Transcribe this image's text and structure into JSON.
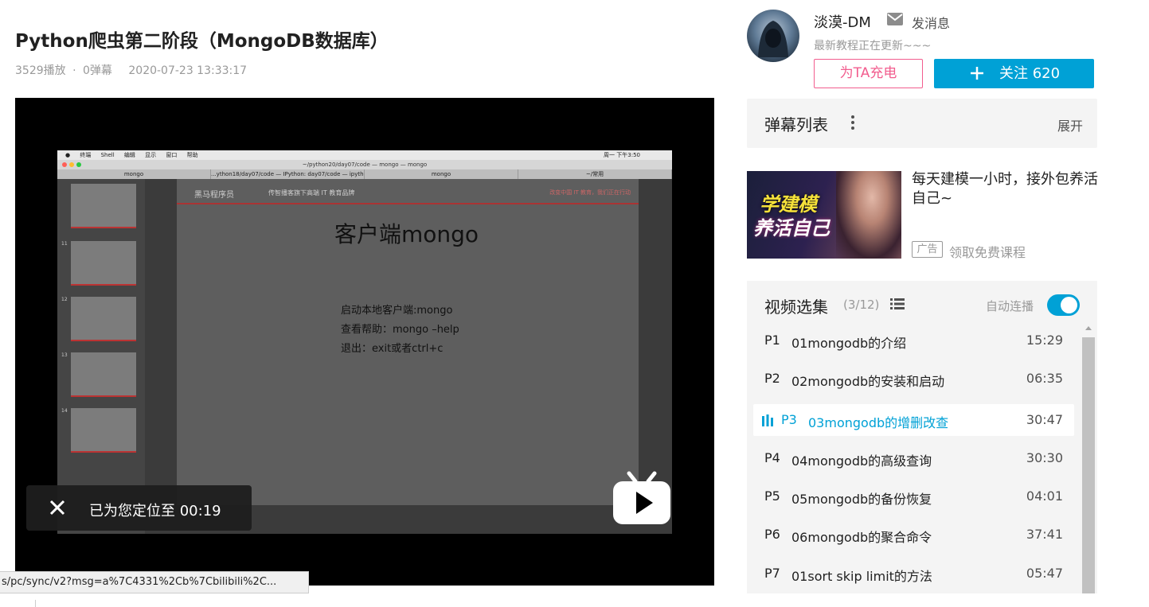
{
  "video": {
    "title": "Python爬虫第二阶段（MongoDB数据库）",
    "plays": "3529播放",
    "separator": "·",
    "danmaku_count": "0弹幕",
    "date": "2020-07-23 13:33:17"
  },
  "player": {
    "terminal_title": "~/python20/day07/code — mongo — mongo",
    "menubar": [
      "终端",
      "Shell",
      "编辑",
      "显示",
      "窗口",
      "帮助"
    ],
    "menubar_right": "周一 下午3:50",
    "tabs": [
      "mongo",
      "...ython18/day07/code — IPython: day07/code — ipython",
      "mongo",
      "~/常用"
    ],
    "slide": {
      "brand": "黑马程序员",
      "subtitle": "传智播客旗下高端 IT 教育品牌",
      "slogan": "改变中国 IT 教育，我们正在行动",
      "heading": "客户端mongo",
      "lines": [
        "启动本地客户端:mongo",
        "查看帮助：mongo –help",
        "退出：exit或者ctrl+c"
      ]
    },
    "thumb_numbers": [
      "11",
      "12",
      "13",
      "14"
    ],
    "toast": "已为您定位至 00:19"
  },
  "url_tip": "s/pc/sync/v2?msg=a%7C4331%2Cb%7Cbilibili%2C...",
  "uploader": {
    "name": "淡漠-DM",
    "message_label": "发消息",
    "description": "最新教程正在更新~~~",
    "charge_label": "为TA充电",
    "follow_label": "关注 620"
  },
  "danmaku_panel": {
    "title": "弹幕列表",
    "expand_label": "展开"
  },
  "ad": {
    "image_text_line1": "学建模",
    "image_text_line2": "养活自己",
    "title": "每天建模一小时，接外包养活自己~",
    "tag": "广告",
    "link": "领取免费课程"
  },
  "playlist": {
    "title": "视频选集",
    "count": "(3/12)",
    "autoplay_label": "自动连播",
    "autoplay_on": true,
    "accent_color": "#00a1d6",
    "items": [
      {
        "page": "P1",
        "name": "01mongodb的介绍",
        "duration": "15:29"
      },
      {
        "page": "P2",
        "name": "02mongodb的安装和启动",
        "duration": "06:35"
      },
      {
        "page": "P3",
        "name": "03mongodb的增删改查",
        "duration": "30:47",
        "active": true
      },
      {
        "page": "P4",
        "name": "04mongodb的高级查询",
        "duration": "30:30"
      },
      {
        "page": "P5",
        "name": "05mongodb的备份恢复",
        "duration": "04:01"
      },
      {
        "page": "P6",
        "name": "06mongodb的聚合命令",
        "duration": "37:41"
      },
      {
        "page": "P7",
        "name": "01sort skip limit的方法",
        "duration": "05:47"
      }
    ]
  }
}
